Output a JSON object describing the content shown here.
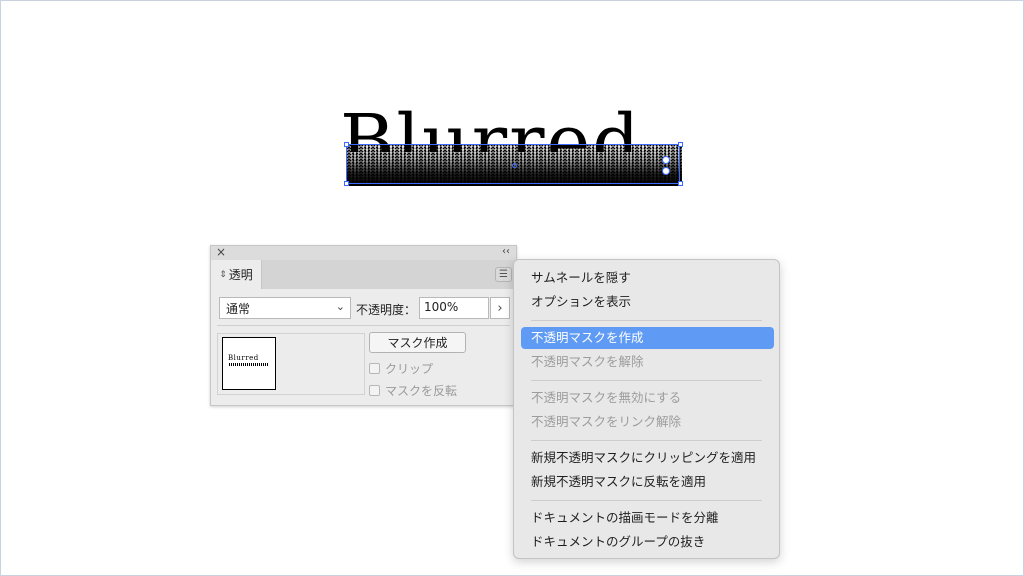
{
  "artwork": {
    "text": "Blurred"
  },
  "panel": {
    "close_icon": "×",
    "collapse_icon": "‹‹",
    "tab_label": "透明",
    "blend_mode": "通常",
    "opacity_label": "不透明度：",
    "opacity_value": "100%",
    "opacity_arrow": "›",
    "thumbnail_text": "Blurred",
    "mask_button": "マスク作成",
    "clip_label": "クリップ",
    "invert_label": "マスクを反転"
  },
  "menu": {
    "items": [
      {
        "label": "サムネールを隠す",
        "enabled": true
      },
      {
        "label": "オプションを表示",
        "enabled": true
      },
      {
        "label": "不透明マスクを作成",
        "enabled": true,
        "highlighted": true
      },
      {
        "label": "不透明マスクを解除",
        "enabled": false
      },
      {
        "label": "不透明マスクを無効にする",
        "enabled": false
      },
      {
        "label": "不透明マスクをリンク解除",
        "enabled": false
      },
      {
        "label": "新規不透明マスクにクリッピングを適用",
        "enabled": true
      },
      {
        "label": "新規不透明マスクに反転を適用",
        "enabled": true
      },
      {
        "label": "ドキュメントの描画モードを分離",
        "enabled": true
      },
      {
        "label": "ドキュメントのグループの抜き",
        "enabled": true
      }
    ]
  },
  "colors": {
    "selection": "#3b6bff",
    "menu_highlight": "#5f9bf4"
  },
  "icons": {
    "panel_menu": "hamburger-icon",
    "tab_toggle": "up-down-arrows-icon",
    "dropdown": "chevron-down-icon"
  }
}
